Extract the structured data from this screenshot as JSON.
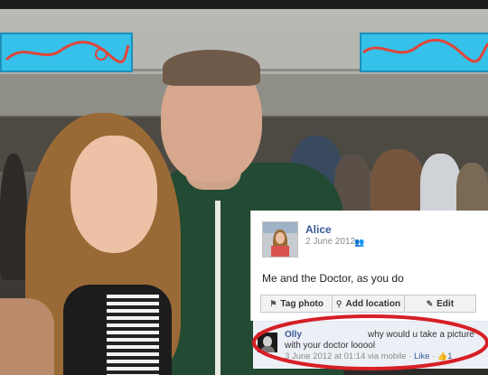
{
  "post": {
    "author": "Alice",
    "date": "2 June 2012",
    "privacy_icon": "friends-icon",
    "caption": "Me and the Doctor, as you do",
    "actions": [
      {
        "label": "Tag photo",
        "icon": "tag-icon"
      },
      {
        "label": "Add location",
        "icon": "location-pin-icon"
      },
      {
        "label": "Edit",
        "icon": "pencil-icon"
      }
    ]
  },
  "comment": {
    "author": "Olly",
    "text_line1": "why would u take a picture",
    "text_line2": "with your doctor looool",
    "meta_prefix": "3 June 2012 at 01:14 via mobile · ",
    "like_label": "Like",
    "separator": " · ",
    "like_count": "1"
  },
  "colors": {
    "link": "#3b5998",
    "comment_bg": "#eceff5",
    "highlight_ellipse": "#d61f26"
  }
}
